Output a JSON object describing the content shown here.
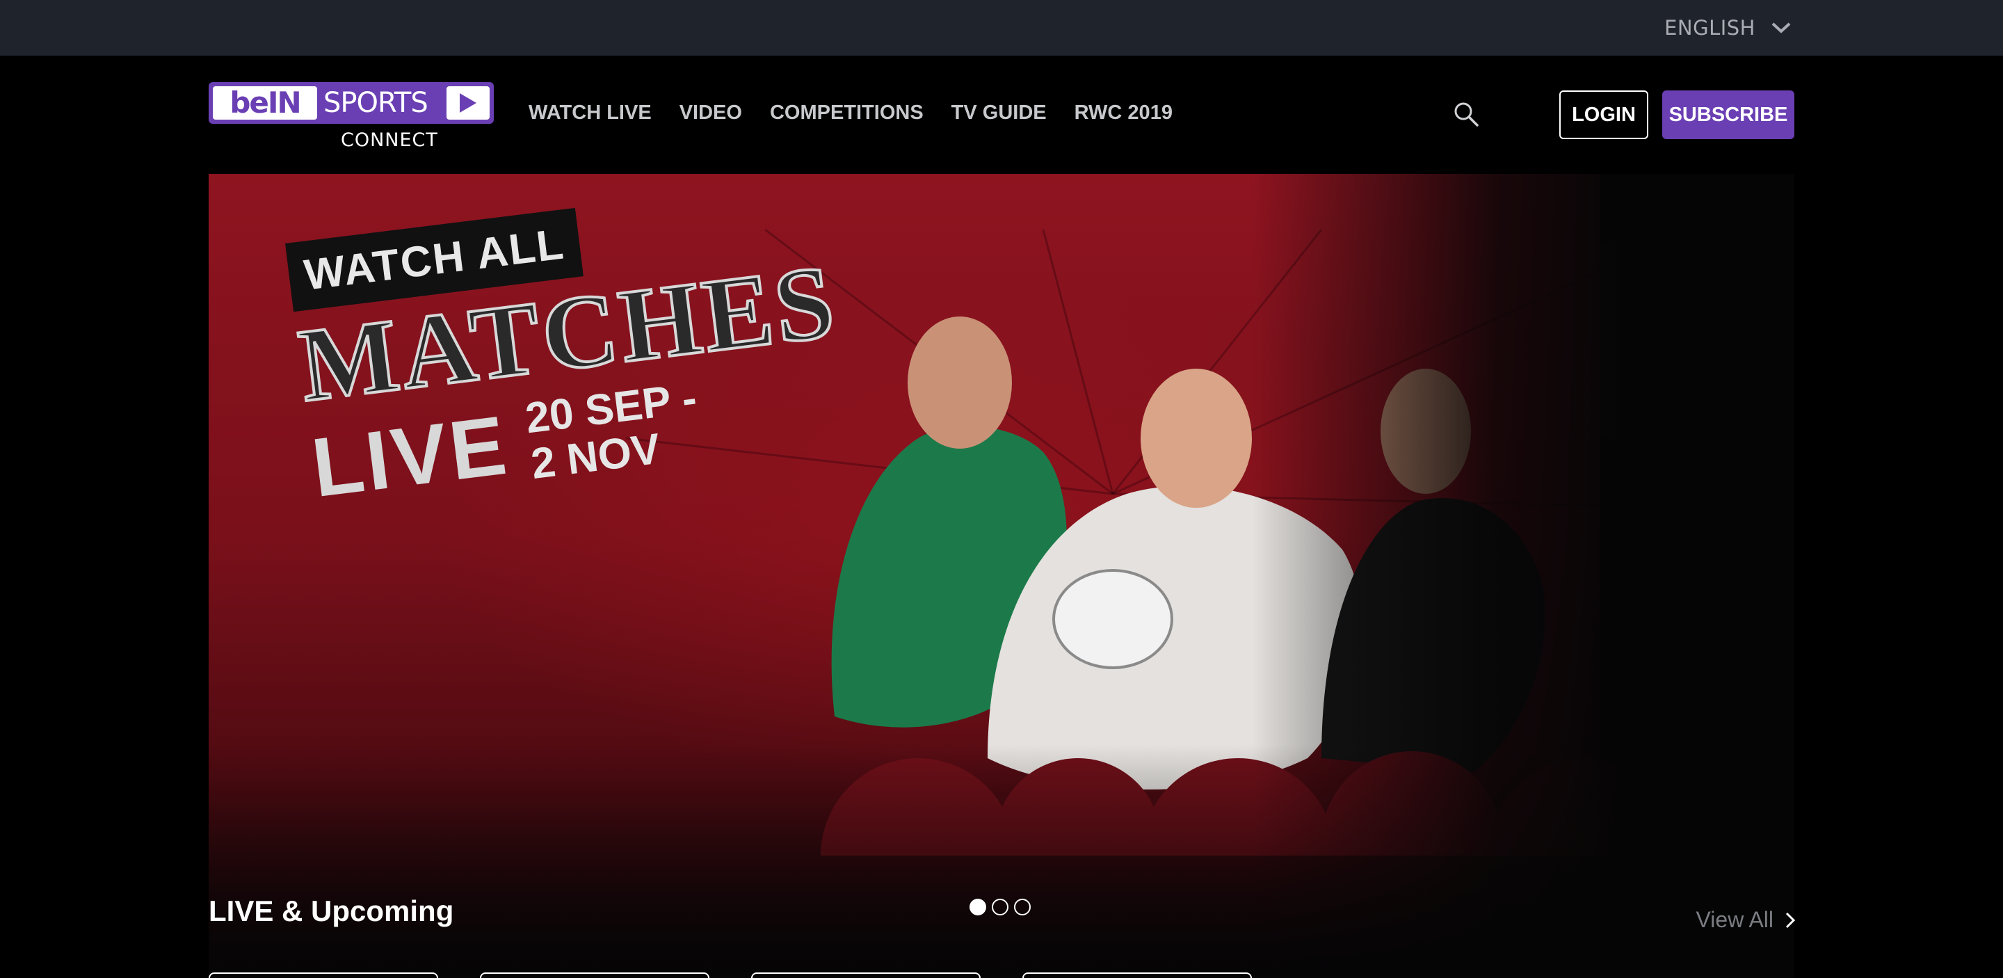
{
  "utility_bar": {
    "language": "ENGLISH",
    "language_icon": "chevron-down-icon"
  },
  "header": {
    "logo": {
      "brand": "beIN",
      "product": "SPORTS",
      "subtitle": "CONNECT"
    },
    "nav": [
      {
        "label": "WATCH LIVE"
      },
      {
        "label": "VIDEO"
      },
      {
        "label": "COMPETITIONS"
      },
      {
        "label": "TV GUIDE"
      },
      {
        "label": "RWC 2019"
      }
    ],
    "search_icon": "search-icon",
    "login_label": "LOGIN",
    "subscribe_label": "SUBSCRIBE"
  },
  "hero": {
    "line1": "WATCH ALL",
    "line2": "MATCHES",
    "line3": "LIVE",
    "date_start": "20 SEP -",
    "date_end": "2 NOV",
    "slide_count": 3,
    "active_slide": 1
  },
  "live_section": {
    "title": "LIVE & Upcoming",
    "view_all_label": "View All",
    "view_all_icon": "chevron-right-icon"
  },
  "colors": {
    "brand_purple": "#6a3fb4",
    "utility_bar": "#1f232c",
    "hero_red": "#8e1420"
  }
}
